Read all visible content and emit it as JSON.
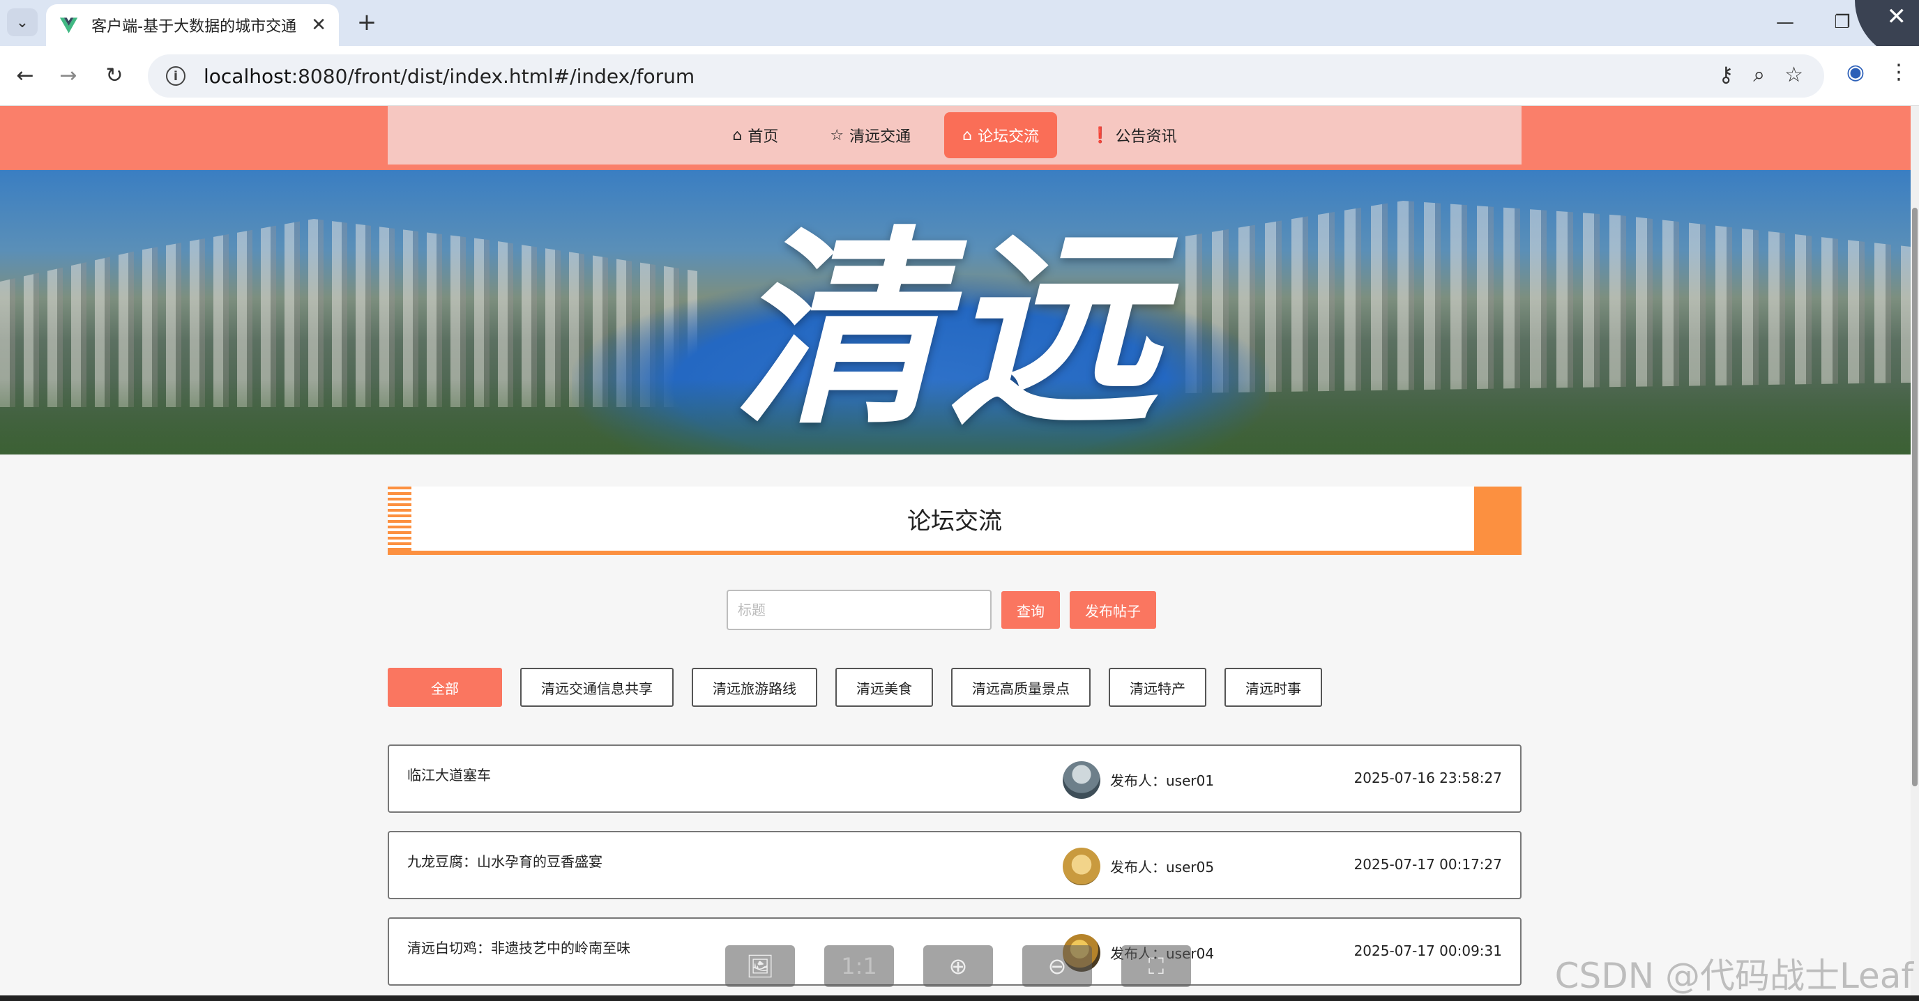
{
  "browser": {
    "tab_title": "客户端-基于大数据的城市交通",
    "url_host": "localhost",
    "url_rest": ":8080/front/dist/index.html#/index/forum"
  },
  "nav": {
    "items": [
      {
        "icon": "⌂",
        "label": "首页",
        "active": false
      },
      {
        "icon": "☆",
        "label": "清远交通",
        "active": false
      },
      {
        "icon": "⌂",
        "label": "论坛交流",
        "active": true
      },
      {
        "icon": "❗",
        "label": "公告资讯",
        "active": false
      }
    ]
  },
  "banner": {
    "logo_text": "清远"
  },
  "section": {
    "title": "论坛交流"
  },
  "search": {
    "placeholder": "标题",
    "query_label": "查询",
    "publish_label": "发布帖子"
  },
  "categories": [
    "全部",
    "清远交通信息共享",
    "清远旅游路线",
    "清远美食",
    "清远高质量景点",
    "清远特产",
    "清远时事"
  ],
  "posts": [
    {
      "title": "临江大道塞车",
      "author": "发布人：user01",
      "time": "2025-07-16 23:58:27"
    },
    {
      "title": "九龙豆腐：山水孕育的豆香盛宴",
      "author": "发布人：user05",
      "time": "2025-07-17 00:17:27"
    },
    {
      "title": "清远白切鸡：非遗技艺中的岭南至味",
      "author": "发布人：user04",
      "time": "2025-07-17 00:09:31"
    }
  ],
  "viewer": {
    "one_to_one": "1:1"
  },
  "watermark": "CSDN @代码战士Leaf",
  "colors": {
    "header": "#fa7f6a",
    "accent": "#fa7660",
    "title_orange": "#fc9040"
  }
}
